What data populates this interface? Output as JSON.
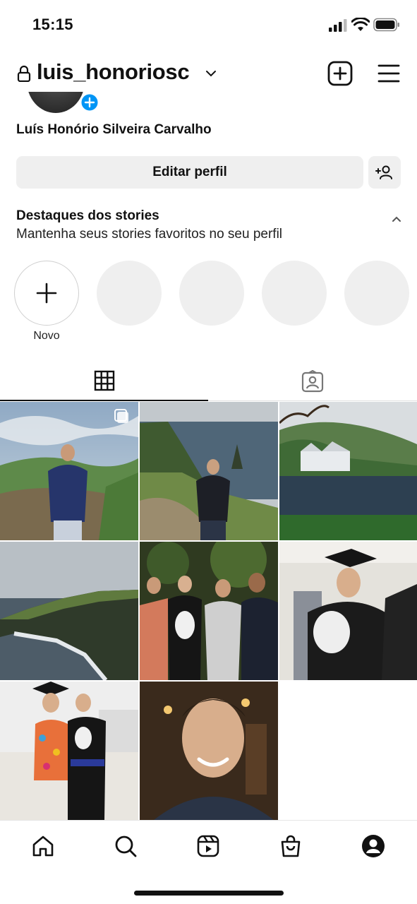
{
  "status_bar": {
    "time": "15:15"
  },
  "header": {
    "username": "luis_honoriosc"
  },
  "profile": {
    "full_name": "Luís Honório Silveira Carvalho",
    "edit_button": "Editar perfil"
  },
  "highlights": {
    "title": "Destaques dos stories",
    "subtitle": "Mantenha seus stories favoritos no seu perfil",
    "new_label": "Novo"
  },
  "tabs": [
    "grid-icon",
    "tagged-icon"
  ],
  "posts": [
    {
      "subject": "man in blue hoodie on hillside",
      "multi": true
    },
    {
      "subject": "man on coastal cliff path",
      "multi": false
    },
    {
      "subject": "abbey by lake",
      "multi": false
    },
    {
      "subject": "sea cliffs",
      "multi": false
    },
    {
      "subject": "graduation group photo",
      "multi": false
    },
    {
      "subject": "graduate in cap and gown",
      "multi": false
    },
    {
      "subject": "graduation couple",
      "multi": false
    },
    {
      "subject": "selfie in restaurant",
      "multi": false
    }
  ],
  "bottom_nav": [
    "home-icon",
    "search-icon",
    "reels-icon",
    "shop-icon",
    "profile-icon"
  ],
  "colors": {
    "accent": "#0095f6",
    "button_bg": "#efefef",
    "text": "#111111"
  }
}
